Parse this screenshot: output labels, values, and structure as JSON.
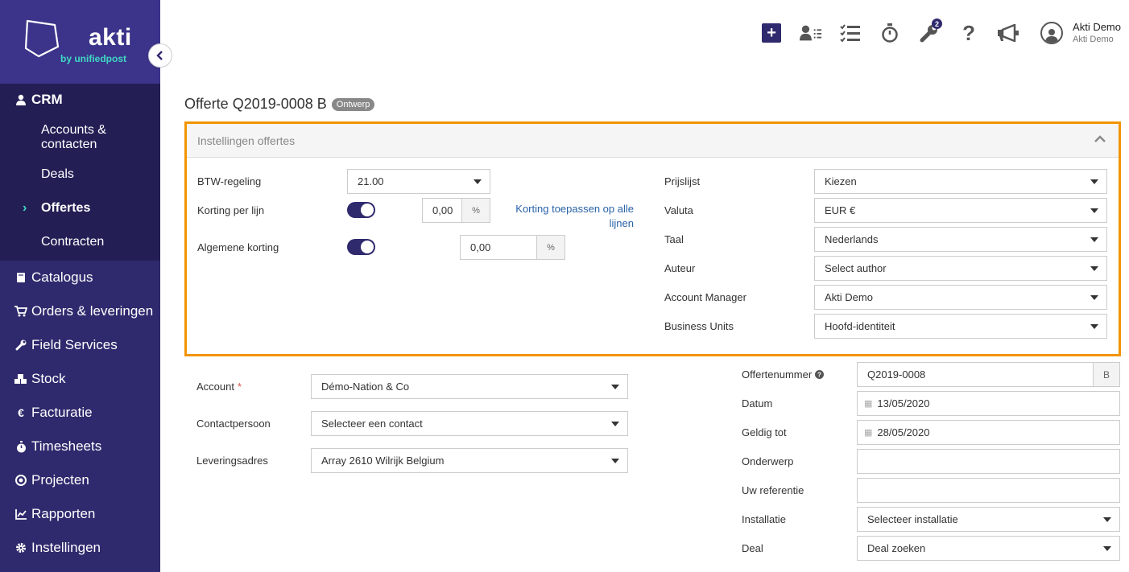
{
  "brand": {
    "name": "akti",
    "tagline": "by unifiedpost"
  },
  "sidebar": {
    "crm_label": "CRM",
    "crm_items": [
      {
        "label": "Accounts & contacten"
      },
      {
        "label": "Deals"
      },
      {
        "label": "Offertes",
        "active": true
      },
      {
        "label": "Contracten"
      }
    ],
    "items": [
      {
        "label": "Catalogus",
        "icon": "book-icon"
      },
      {
        "label": "Orders & leveringen",
        "icon": "cart-icon"
      },
      {
        "label": "Field Services",
        "icon": "wrench-icon"
      },
      {
        "label": "Stock",
        "icon": "cubes-icon"
      },
      {
        "label": "Facturatie",
        "icon": "euro-icon"
      },
      {
        "label": "Timesheets",
        "icon": "stopwatch-icon"
      },
      {
        "label": "Projecten",
        "icon": "target-icon"
      },
      {
        "label": "Rapporten",
        "icon": "chart-icon"
      },
      {
        "label": "Instellingen",
        "icon": "gear-icon"
      }
    ]
  },
  "topbar": {
    "badge_count": "2",
    "user_name": "Akti Demo",
    "user_company": "Akti Demo"
  },
  "page": {
    "title": "Offerte Q2019-0008 B",
    "status": "Ontwerp"
  },
  "settings": {
    "title": "Instellingen offertes",
    "btw_label": "BTW-regeling",
    "btw_value": "21.00",
    "korting_lijn_label": "Korting per lijn",
    "korting_lijn_value": "0,00",
    "percent": "%",
    "korting_link": "Korting toepassen op alle lijnen",
    "algemene_korting_label": "Algemene korting",
    "algemene_korting_value": "0,00",
    "prijslijst_label": "Prijslijst",
    "prijslijst_value": "Kiezen",
    "valuta_label": "Valuta",
    "valuta_value": "EUR €",
    "taal_label": "Taal",
    "taal_value": "Nederlands",
    "auteur_label": "Auteur",
    "auteur_value": "Select author",
    "account_manager_label": "Account Manager",
    "account_manager_value": "Akti Demo",
    "business_units_label": "Business Units",
    "business_units_value": "Hoofd-identiteit"
  },
  "form": {
    "account_label": "Account",
    "required_mark": "*",
    "account_value": "Démo-Nation & Co",
    "contact_label": "Contactpersoon",
    "contact_value": "Selecteer een contact",
    "levering_label": "Leveringsadres",
    "levering_value": "Array 2610 Wilrijk Belgium",
    "offertenummer_label": "Offertenummer",
    "offertenummer_value": "Q2019-0008",
    "offertenummer_suffix": "B",
    "datum_label": "Datum",
    "datum_value": "13/05/2020",
    "geldig_label": "Geldig tot",
    "geldig_value": "28/05/2020",
    "onderwerp_label": "Onderwerp",
    "onderwerp_value": "",
    "referentie_label": "Uw referentie",
    "referentie_value": "",
    "installatie_label": "Installatie",
    "installatie_value": "Selecteer installatie",
    "deal_label": "Deal",
    "deal_value": "Deal zoeken"
  },
  "colors": {
    "sidebar": "#2f2a6d",
    "accent": "#40d9c4",
    "highlight_border": "#f29400",
    "link": "#2a62a8"
  }
}
